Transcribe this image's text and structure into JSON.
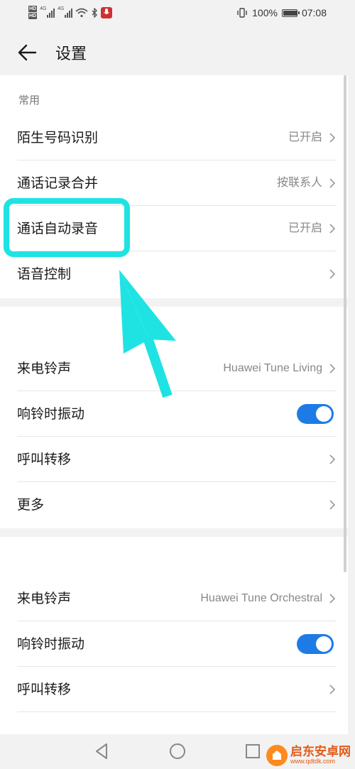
{
  "status_bar": {
    "hd_top": "HD",
    "hd_bottom": "HD",
    "net_1": "4G",
    "net_2": "4G",
    "battery_text": "100%",
    "battery_level": 1.0,
    "time": "07:08",
    "icons": [
      "hd-icon",
      "signal-icon",
      "wifi-icon",
      "bluetooth-icon",
      "recording-icon",
      "vibrate-icon",
      "battery-icon"
    ]
  },
  "header": {
    "back_icon": "back-arrow-icon",
    "title": "设置"
  },
  "section_common": {
    "title": "常用",
    "rows": [
      {
        "label": "陌生号码识别",
        "value": "已开启"
      },
      {
        "label": "通话记录合并",
        "value": "按联系人"
      },
      {
        "label": "通话自动录音",
        "value": "已开启"
      },
      {
        "label": "语音控制",
        "value": ""
      }
    ]
  },
  "section_sim1": {
    "ringtone_label": "来电铃声",
    "ringtone_value": "Huawei Tune Living",
    "vibrate_label": "响铃时振动",
    "vibrate_on": true,
    "forward_label": "呼叫转移",
    "more_label": "更多"
  },
  "section_sim2": {
    "ringtone_label": "来电铃声",
    "ringtone_value": "Huawei Tune Orchestral",
    "vibrate_label": "响铃时振动",
    "vibrate_on": true,
    "forward_label": "呼叫转移"
  },
  "annotation": {
    "highlight_color": "#1fe3e3"
  },
  "nav_bar": {
    "icons": [
      "nav-back-icon",
      "nav-home-icon",
      "nav-recents-icon"
    ]
  },
  "watermark": {
    "name": "启东安卓网",
    "url": "www.qdtdk.com"
  },
  "colors": {
    "accent": "#1e7be6",
    "background": "#f2f2f2"
  }
}
